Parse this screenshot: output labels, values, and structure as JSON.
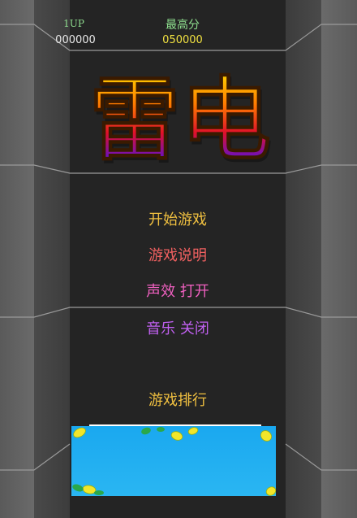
{
  "hud": {
    "player_label": "1UP",
    "player_score": "000000",
    "hiscore_label": "最高分",
    "hiscore_value": "050000"
  },
  "logo": {
    "title": "雷电"
  },
  "menu": {
    "start": "开始游戏",
    "help": "游戏说明",
    "sound": "声效 打开",
    "music": "音乐 关闭",
    "ranking": "游戏排行"
  },
  "colors": {
    "background": "#262626",
    "hud_green": "#8fe08f",
    "hiscore_yellow": "#f0e040",
    "menu_start": "#f0c040",
    "menu_help": "#f06060",
    "menu_sound": "#f060c0",
    "menu_music": "#c060f0",
    "water": "#1aa8f0"
  }
}
